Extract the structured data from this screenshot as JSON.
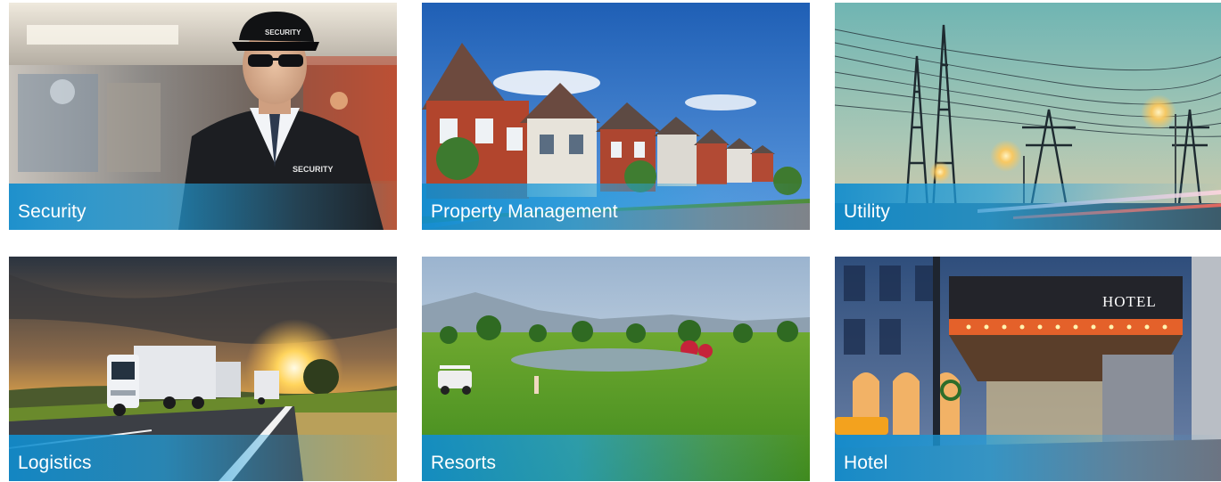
{
  "tiles": [
    {
      "id": "security",
      "label": "Security",
      "image_icon": "security-guard-photo",
      "badge_text": "SECURITY"
    },
    {
      "id": "property-management",
      "label": "Property Management",
      "image_icon": "suburban-houses-photo"
    },
    {
      "id": "utility",
      "label": "Utility",
      "image_icon": "power-lines-photo"
    },
    {
      "id": "logistics",
      "label": "Logistics",
      "image_icon": "truck-highway-photo"
    },
    {
      "id": "resorts",
      "label": "Resorts",
      "image_icon": "golf-course-photo"
    },
    {
      "id": "hotel",
      "label": "Hotel",
      "image_icon": "hotel-entrance-photo",
      "sign_text": "HOTEL"
    }
  ],
  "colors": {
    "caption_blue": "#108ccd",
    "caption_text": "#ffffff"
  }
}
